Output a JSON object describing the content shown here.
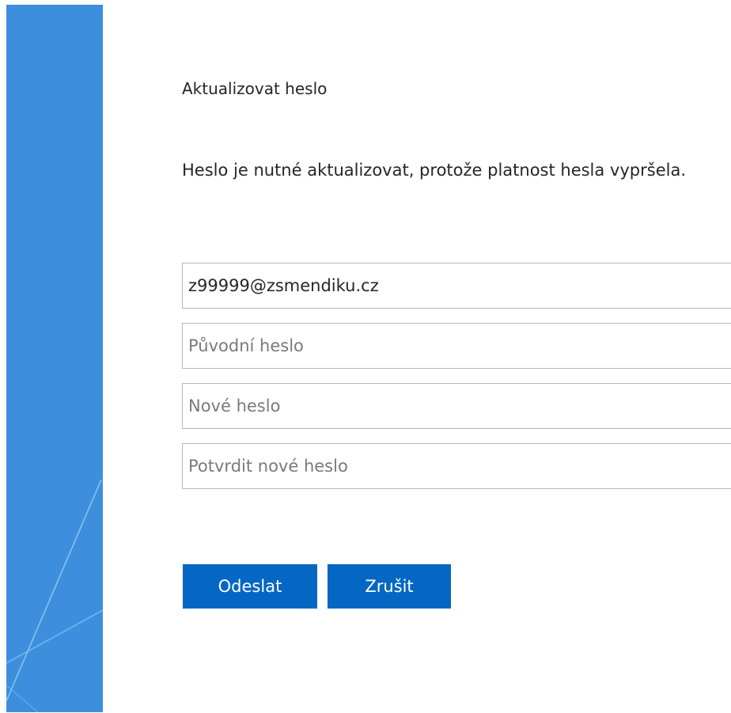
{
  "form": {
    "title": "Aktualizovat heslo",
    "message": "Heslo je nutné aktualizovat, protože platnost hesla vypršela.",
    "username_value": "z99999@zsmendiku.cz",
    "old_password_placeholder": "Původní heslo",
    "new_password_placeholder": "Nové heslo",
    "confirm_password_placeholder": "Potvrdit nové heslo",
    "submit_label": "Odeslat",
    "cancel_label": "Zrušit"
  },
  "colors": {
    "side_panel": "#3d8fde",
    "button": "#0567c4",
    "field_border": "#b8b8b8",
    "text": "#262626"
  }
}
